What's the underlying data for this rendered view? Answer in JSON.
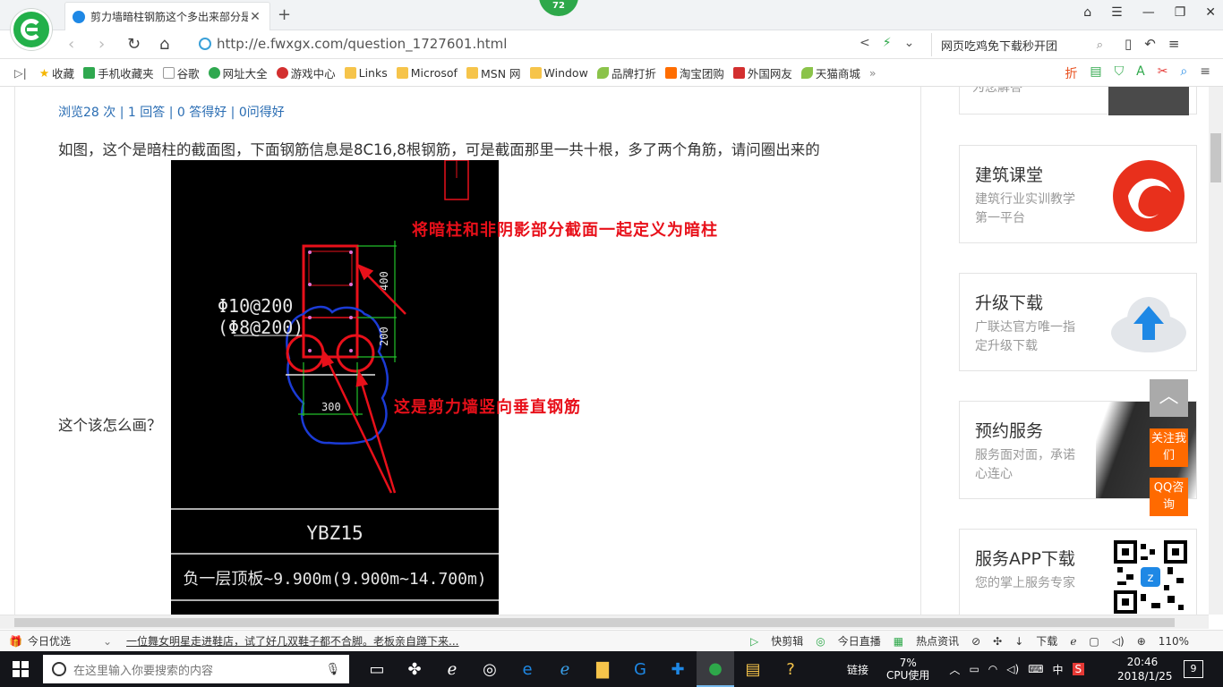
{
  "browser": {
    "tab_title": "剪力墙暗柱钢筋这个多出来部分是",
    "badge": "72",
    "url": "http://e.fwxgx.com/question_1727601.html",
    "search_text": "网页吃鸡免下载秒开团"
  },
  "bookmarks": [
    {
      "label": "收藏",
      "icon": "star-icon"
    },
    {
      "label": "手机收藏夹",
      "icon": "phone-icon"
    },
    {
      "label": "谷歌",
      "icon": "doc-icon"
    },
    {
      "label": "网址大全",
      "icon": "red-circle-icon"
    },
    {
      "label": "游戏中心",
      "icon": "game-icon"
    },
    {
      "label": "Links",
      "icon": "folder-icon"
    },
    {
      "label": "Microsof",
      "icon": "folder-icon"
    },
    {
      "label": "MSN 网",
      "icon": "folder-icon"
    },
    {
      "label": "Window",
      "icon": "folder-icon"
    },
    {
      "label": "品牌打折",
      "icon": "leaf-icon"
    },
    {
      "label": "淘宝团购",
      "icon": "taobao-icon"
    },
    {
      "label": "外国网友",
      "icon": "red-icon"
    },
    {
      "label": "天猫商城",
      "icon": "leaf-icon"
    }
  ],
  "page": {
    "stats": "浏览28 次 | 1 回答 | 0 答得好 | 0问得好",
    "question_line1": "如图，这个是暗柱的截面图，下面钢筋信息是8C16,8根钢筋，可是截面那里一共十根，多了两个角筋，请问圈出来的",
    "question_line2": "这个该怎么画？",
    "annotation1": "将暗柱和非阴影部分截面一起定义为暗柱",
    "annotation2": "这是剪力墙竖向垂直钢筋",
    "cad": {
      "stirrup": "Φ10@200",
      "stirrup2": "(Φ8@200)",
      "dim_400": "400",
      "dim_200": "200",
      "dim_300": "300",
      "label": "YBZ15",
      "elevation": "负一层顶板~9.900m(9.900m~14.700m)"
    }
  },
  "sidebar": {
    "top_card_desc": "为您解答",
    "cards": [
      {
        "title": "建筑课堂",
        "desc": "建筑行业实训教学第一平台"
      },
      {
        "title": "升级下载",
        "desc": "广联达官方唯一指定升级下载"
      },
      {
        "title": "预约服务",
        "desc": "服务面对面，承诺心连心"
      },
      {
        "title": "服务APP下载",
        "desc": "您的掌上服务专家"
      }
    ],
    "float_follow": "关注我们",
    "float_qq": "QQ咨询"
  },
  "statusbar": {
    "today": "今日优选",
    "news": "一位舞女明星走进鞋店，试了好几双鞋子都不合脚。老板亲自蹲下来...",
    "items": [
      "快剪辑",
      "今日直播",
      "热点资讯",
      "下载"
    ],
    "zoom": "110%"
  },
  "taskbar": {
    "search_placeholder": "在这里输入你要搜索的内容",
    "tray_link": "链接",
    "cpu_pct": "7%",
    "cpu_label": "CPU使用",
    "ime": "中",
    "time": "20:46",
    "date": "2018/1/25",
    "notif_count": "9"
  }
}
